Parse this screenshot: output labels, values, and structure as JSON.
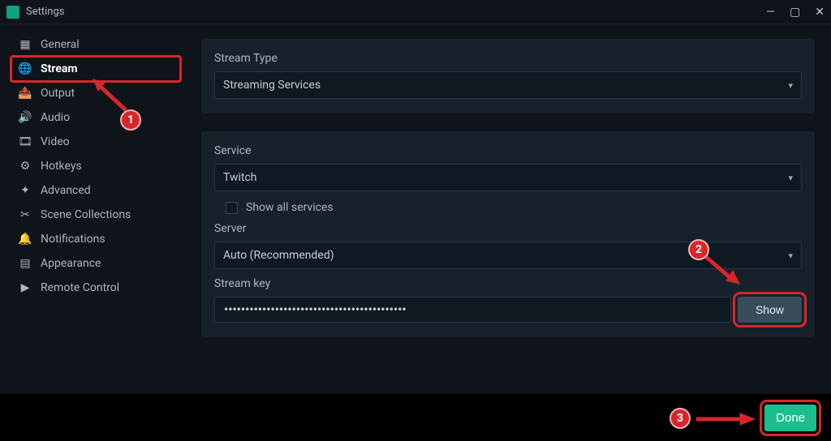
{
  "window": {
    "title": "Settings"
  },
  "sidebar": {
    "items": [
      {
        "label": "General"
      },
      {
        "label": "Stream",
        "active": true
      },
      {
        "label": "Output"
      },
      {
        "label": "Audio"
      },
      {
        "label": "Video"
      },
      {
        "label": "Hotkeys"
      },
      {
        "label": "Advanced"
      },
      {
        "label": "Scene Collections"
      },
      {
        "label": "Notifications"
      },
      {
        "label": "Appearance"
      },
      {
        "label": "Remote Control"
      }
    ]
  },
  "panels": {
    "stream_type": {
      "label": "Stream Type",
      "value": "Streaming Services"
    },
    "service": {
      "label": "Service",
      "value": "Twitch",
      "show_all_label": "Show all services",
      "server_label": "Server",
      "server_value": "Auto (Recommended)",
      "stream_key_label": "Stream key",
      "stream_key_mask": "•••••••••••••••••••••••••••••••••••••••••••",
      "show_btn": "Show"
    }
  },
  "footer": {
    "done": "Done"
  },
  "annotations": {
    "n1": "1",
    "n2": "2",
    "n3": "3"
  },
  "icons": {
    "general": "▦",
    "stream": "🌐",
    "output": "📤",
    "audio": "🔊",
    "video": "🎞",
    "hotkeys": "⚙",
    "advanced": "✦",
    "scene": "✂",
    "notify": "🔔",
    "appearance": "▤",
    "remote": "▶"
  }
}
